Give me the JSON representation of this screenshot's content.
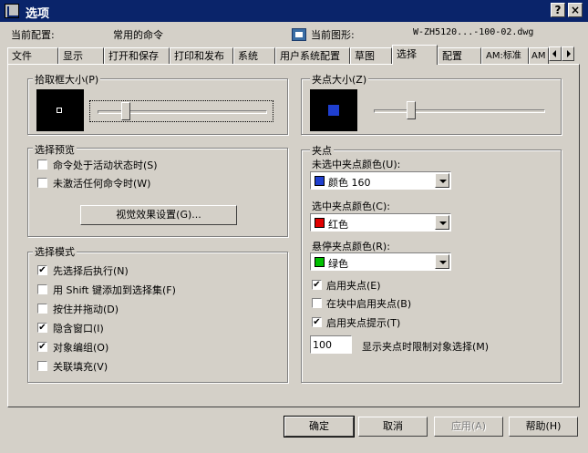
{
  "window": {
    "title": "选项",
    "help_btn": "?",
    "close_btn": "×"
  },
  "header": {
    "profile_label": "当前配置:",
    "profile_value": "常用的命令",
    "drawing_label": "当前图形:",
    "drawing_value": "W-ZH5120...-100-02.dwg"
  },
  "tabs": [
    {
      "label": "文件"
    },
    {
      "label": "显示"
    },
    {
      "label": "打开和保存"
    },
    {
      "label": "打印和发布"
    },
    {
      "label": "系统"
    },
    {
      "label": "用户系统配置"
    },
    {
      "label": "草图"
    },
    {
      "label": "选择",
      "active": true
    },
    {
      "label": "配置"
    },
    {
      "label": "AM:标准"
    },
    {
      "label": "AM"
    }
  ],
  "pickbox": {
    "title": "拾取框大小(P)",
    "level": 0.15
  },
  "grip_size": {
    "title": "夹点大小(Z)",
    "level": 0.2
  },
  "selection_preview": {
    "title": "选择预览",
    "items": [
      {
        "label": "命令处于活动状态时(S)",
        "checked": false
      },
      {
        "label": "未激活任何命令时(W)",
        "checked": false
      }
    ],
    "visual_btn": "视觉效果设置(G)..."
  },
  "selection_modes": {
    "title": "选择模式",
    "items": [
      {
        "label": "先选择后执行(N)",
        "checked": true
      },
      {
        "label": "用 Shift 键添加到选择集(F)",
        "checked": false
      },
      {
        "label": "按住并拖动(D)",
        "checked": false
      },
      {
        "label": "隐含窗口(I)",
        "checked": true
      },
      {
        "label": "对象编组(O)",
        "checked": true
      },
      {
        "label": "关联填充(V)",
        "checked": false
      }
    ]
  },
  "grips": {
    "title": "夹点",
    "unselected_label": "未选中夹点颜色(U):",
    "unselected_value": "颜色 160",
    "unselected_color": "#1f3fcf",
    "selected_label": "选中夹点颜色(C):",
    "selected_value": "红色",
    "selected_color": "#e00000",
    "hover_label": "悬停夹点颜色(R):",
    "hover_value": "绿色",
    "hover_color": "#00c000",
    "checks": [
      {
        "label": "启用夹点(E)",
        "checked": true
      },
      {
        "label": "在块中启用夹点(B)",
        "checked": false
      },
      {
        "label": "启用夹点提示(T)",
        "checked": true
      }
    ],
    "limit_value": "100",
    "limit_label": "显示夹点时限制对象选择(M)"
  },
  "buttons": {
    "ok": "确定",
    "cancel": "取消",
    "apply": "应用(A)",
    "help": "帮助(H)"
  },
  "colors": {
    "title_bg": "#0a246a",
    "grip_square": "#1f3fcf",
    "face": "#d4d0c8"
  }
}
